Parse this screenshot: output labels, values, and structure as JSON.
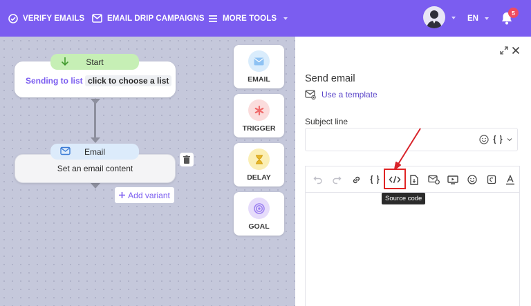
{
  "nav": {
    "verify_emails": "VERIFY EMAILS",
    "email_drip": "EMAIL DRIP CAMPAIGNS",
    "more_tools": "MORE TOOLS",
    "lang": "EN",
    "notifications": "5"
  },
  "flow": {
    "start_label": "Start",
    "sending_to": "Sending to list",
    "choose_list": "click to choose a list",
    "email_label": "Email",
    "email_content": "Set an email content",
    "add_variant": "Add variant"
  },
  "palette": {
    "email": "EMAIL",
    "trigger": "TRIGGER",
    "delay": "DELAY",
    "goal": "GOAL"
  },
  "panel": {
    "title": "Send email",
    "use_template": "Use a template",
    "subject_label": "Subject line",
    "subject_value": "",
    "tooltip": "Source code"
  },
  "colors": {
    "brand": "#7b5df0",
    "start_tag": "#c6efb5",
    "email_tag": "#dcebfb",
    "highlight": "#e02424"
  },
  "icons": [
    "verify-icon",
    "mail-icon",
    "menu-icon",
    "avatar",
    "bell-icon",
    "expand-icon",
    "close-icon",
    "template-icon",
    "smile-icon",
    "braces-icon",
    "undo-icon",
    "redo-icon",
    "link-icon",
    "source-code-icon",
    "file-icon",
    "mail-settings-icon",
    "video-icon",
    "emoji-icon",
    "copy-icon",
    "text-color-icon",
    "trash-icon",
    "plus-icon",
    "hourglass-icon",
    "asterisk-icon",
    "target-icon",
    "arrow-down-icon"
  ]
}
